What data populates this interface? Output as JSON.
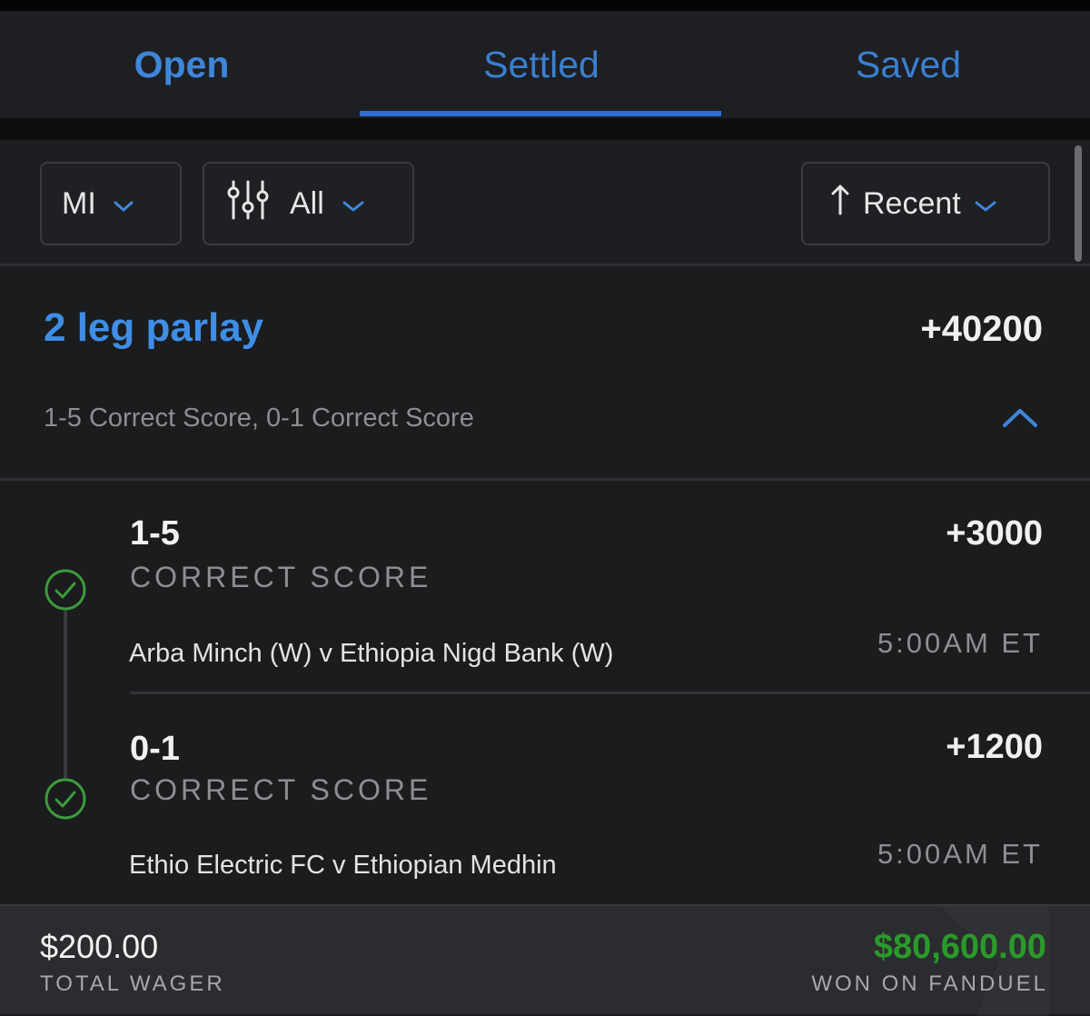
{
  "tabs": [
    {
      "label": "Open",
      "active": false
    },
    {
      "label": "Settled",
      "active": true
    },
    {
      "label": "Saved",
      "active": false
    }
  ],
  "filters": {
    "state": "MI",
    "bet_type": "All",
    "sort": "Recent"
  },
  "parlay": {
    "title": "2 leg parlay",
    "odds": "+40200",
    "summary": "1-5 Correct Score, 0-1 Correct Score"
  },
  "legs": [
    {
      "pick": "1-5",
      "market": "CORRECT SCORE",
      "event": "Arba Minch  (W) v Ethiopia Nigd Bank (W)",
      "odds": "+3000",
      "time": "5:00AM ET",
      "status": "won"
    },
    {
      "pick": "0-1",
      "market": "CORRECT SCORE",
      "event": "Ethio Electric FC v Ethiopian Medhin",
      "odds": "+1200",
      "time": "5:00AM ET",
      "status": "won"
    }
  ],
  "footer": {
    "wager_amount": "$200.00",
    "wager_label": "TOTAL WAGER",
    "won_amount": "$80,600.00",
    "won_label": "WON ON FANDUEL"
  },
  "colors": {
    "accent": "#3f86d9",
    "win_green": "#2a9a2a",
    "check_green": "#3d9a3d",
    "background": "#1b1c1e"
  },
  "icons": {
    "filter": "sliders-icon",
    "sort": "arrow-up-icon",
    "dropdown": "chevron-down-icon",
    "collapse": "chevron-up-icon",
    "leg_status": "check-circle-icon"
  }
}
